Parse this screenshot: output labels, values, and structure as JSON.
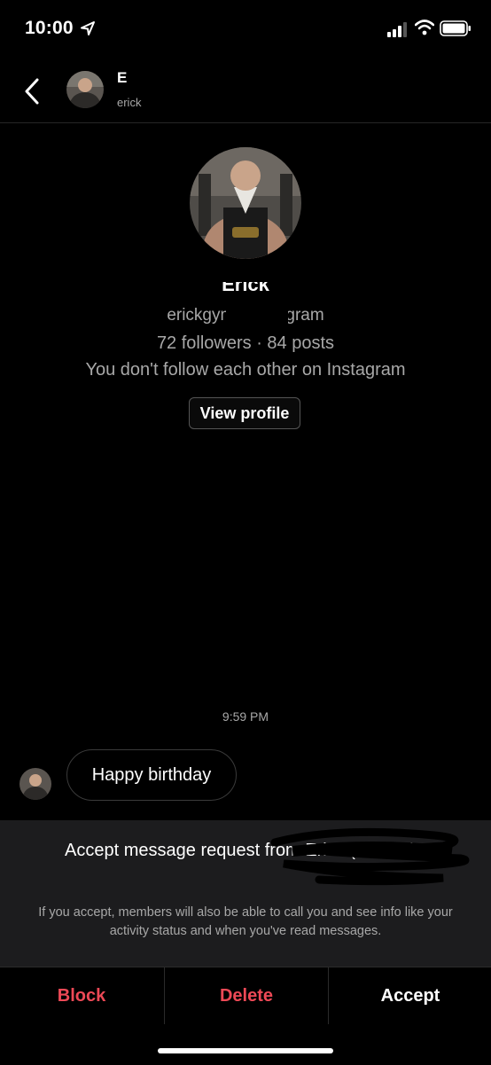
{
  "status_bar": {
    "time": "10:00"
  },
  "header": {
    "name": "E",
    "username": "erick"
  },
  "profile": {
    "name": "Erick",
    "handle": "erickgym · Instagram",
    "stats": "72 followers · 84 posts",
    "follow_status": "You don't follow each other on Instagram",
    "view_profile_label": "View profile"
  },
  "conversation": {
    "timestamp": "9:59 PM",
    "messages": [
      {
        "text": "Happy birthday",
        "from": "other"
      }
    ]
  },
  "request": {
    "title": "Accept message request from Erick (erick…)?",
    "info": "If you accept, members will also be able to call you and see info like your activity status and when you've read messages."
  },
  "actions": {
    "block": "Block",
    "delete": "Delete",
    "accept": "Accept"
  },
  "colors": {
    "background": "#000000",
    "danger": "#ed4956",
    "secondary_text": "#a8a8a8",
    "panel": "#1c1c1e"
  },
  "icons": [
    "location-arrow-icon",
    "signal-icon",
    "wifi-icon",
    "battery-icon",
    "back-chevron-icon"
  ]
}
